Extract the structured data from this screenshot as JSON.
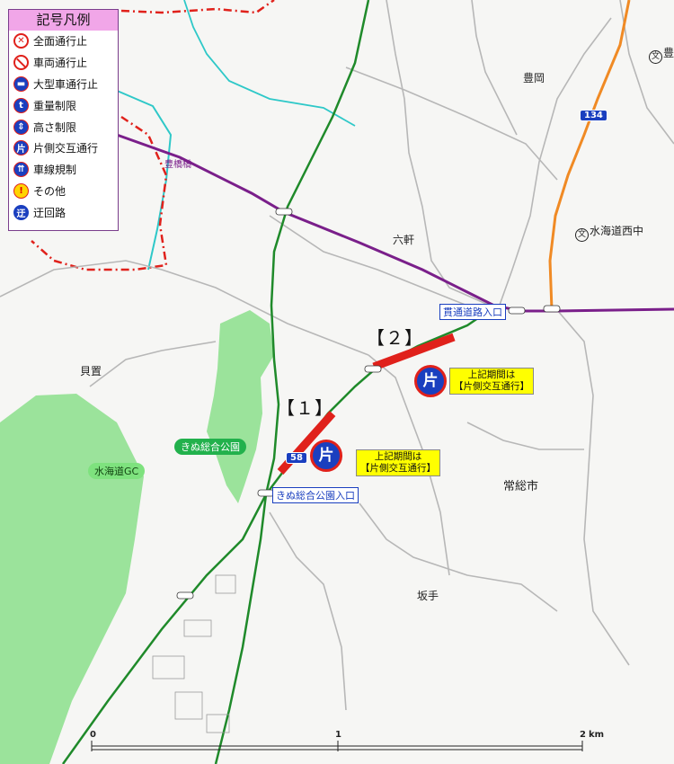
{
  "legend": {
    "title": "記号凡例",
    "items": [
      {
        "label": "全面通行止",
        "icon": "full-closure-icon"
      },
      {
        "label": "車両通行止",
        "icon": "no-vehicles-icon"
      },
      {
        "label": "大型車通行止",
        "icon": "no-large-vehicles-icon"
      },
      {
        "label": "重量制限",
        "icon": "weight-limit-icon"
      },
      {
        "label": "高さ制限",
        "icon": "height-limit-icon"
      },
      {
        "label": "片側交互通行",
        "icon": "alternating-traffic-icon"
      },
      {
        "label": "車線規制",
        "icon": "lane-restriction-icon"
      },
      {
        "label": "その他",
        "icon": "other-icon"
      },
      {
        "label": "迂回路",
        "icon": "detour-icon"
      }
    ]
  },
  "places": {
    "toyooka": "豊岡",
    "rokken": "六軒",
    "kaimoku": "貝置",
    "jososhi": "常総市",
    "sakate": "坂手",
    "toyobashi": "豊橋橋",
    "school_top": "豊",
    "school_mid": "水海道西中"
  },
  "facilities": {
    "kimeso_park": "きぬ総合公園",
    "mitsukaido_gc": "水海道GC",
    "kantsu_entrance": "貫通道路入口",
    "kimeso_entrance": "きぬ総合公園入口"
  },
  "routes": {
    "r134": "134",
    "r58": "58"
  },
  "sections": {
    "s1": "【１】",
    "s2": "【２】"
  },
  "notes": {
    "note1": [
      "上記期間は",
      "【片側交互通行】"
    ],
    "note2": [
      "上記期間は",
      "【片側交互通行】"
    ]
  },
  "badge_char": "片",
  "scale": {
    "ticks": [
      "0",
      "1",
      "2"
    ],
    "unit": "km"
  },
  "colors": {
    "restriction_red": "#e0211b",
    "route_green": "#1f8a2a",
    "route_purple": "#7a1f8a",
    "route_orange": "#f08a24",
    "park_green": "#9be39b",
    "boundary_red": "#e0211b",
    "river_cyan": "#2ec8c8"
  }
}
